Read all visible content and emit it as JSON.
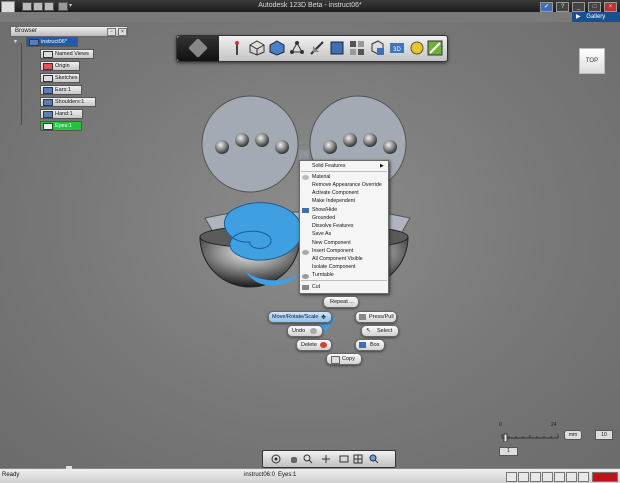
{
  "window": {
    "title": "Autodesk 123D Beta - instruct06*",
    "gallery_label": "Gallery"
  },
  "browser": {
    "title": "Browser",
    "root": "instruct06*",
    "items": [
      {
        "label": "Named Views"
      },
      {
        "label": "Origin"
      },
      {
        "label": "Sketches"
      },
      {
        "label": "Ears:1"
      },
      {
        "label": "Shoulders:1"
      },
      {
        "label": "Hand:1"
      },
      {
        "label": "Eyes:1"
      }
    ]
  },
  "viewcube": {
    "label": "TOP"
  },
  "context_menu": {
    "items": [
      {
        "label": "Solid Features",
        "has_submenu": true
      },
      {
        "label": "Material"
      },
      {
        "label": "Remove Appearance Override"
      },
      {
        "label": "Activate Component"
      },
      {
        "label": "Make Independent"
      },
      {
        "label": "Show/Hide"
      },
      {
        "label": "Grounded"
      },
      {
        "label": "Dissolve Features"
      },
      {
        "label": "Save As"
      },
      {
        "label": "New Component"
      },
      {
        "label": "Insert Component"
      },
      {
        "label": "All Component Visible"
      },
      {
        "label": "Isolate Component"
      },
      {
        "label": "Turntable"
      },
      {
        "label": "Cut"
      }
    ],
    "submenu_arrow": "▶"
  },
  "marking_menu": {
    "repeat": "Repeat ...",
    "move": "Move/Rotate/Scale",
    "press_pull": "Press/Pull",
    "undo": "Undo",
    "select": "Select",
    "delete": "Delete",
    "box": "Box",
    "copy": "Copy"
  },
  "grid_scale": {
    "tick_start": "0",
    "tick_end": "24",
    "unit": "mm",
    "snap_value": "10",
    "small_value": "1"
  },
  "status_bar": {
    "ready": "Ready",
    "document": "instruct06:0",
    "selection": "Eyes:1"
  },
  "colors": {
    "selection_blue": "#3f9fe0",
    "active_node_green": "#23c43a",
    "root_node_blue": "#1c5ca8"
  }
}
